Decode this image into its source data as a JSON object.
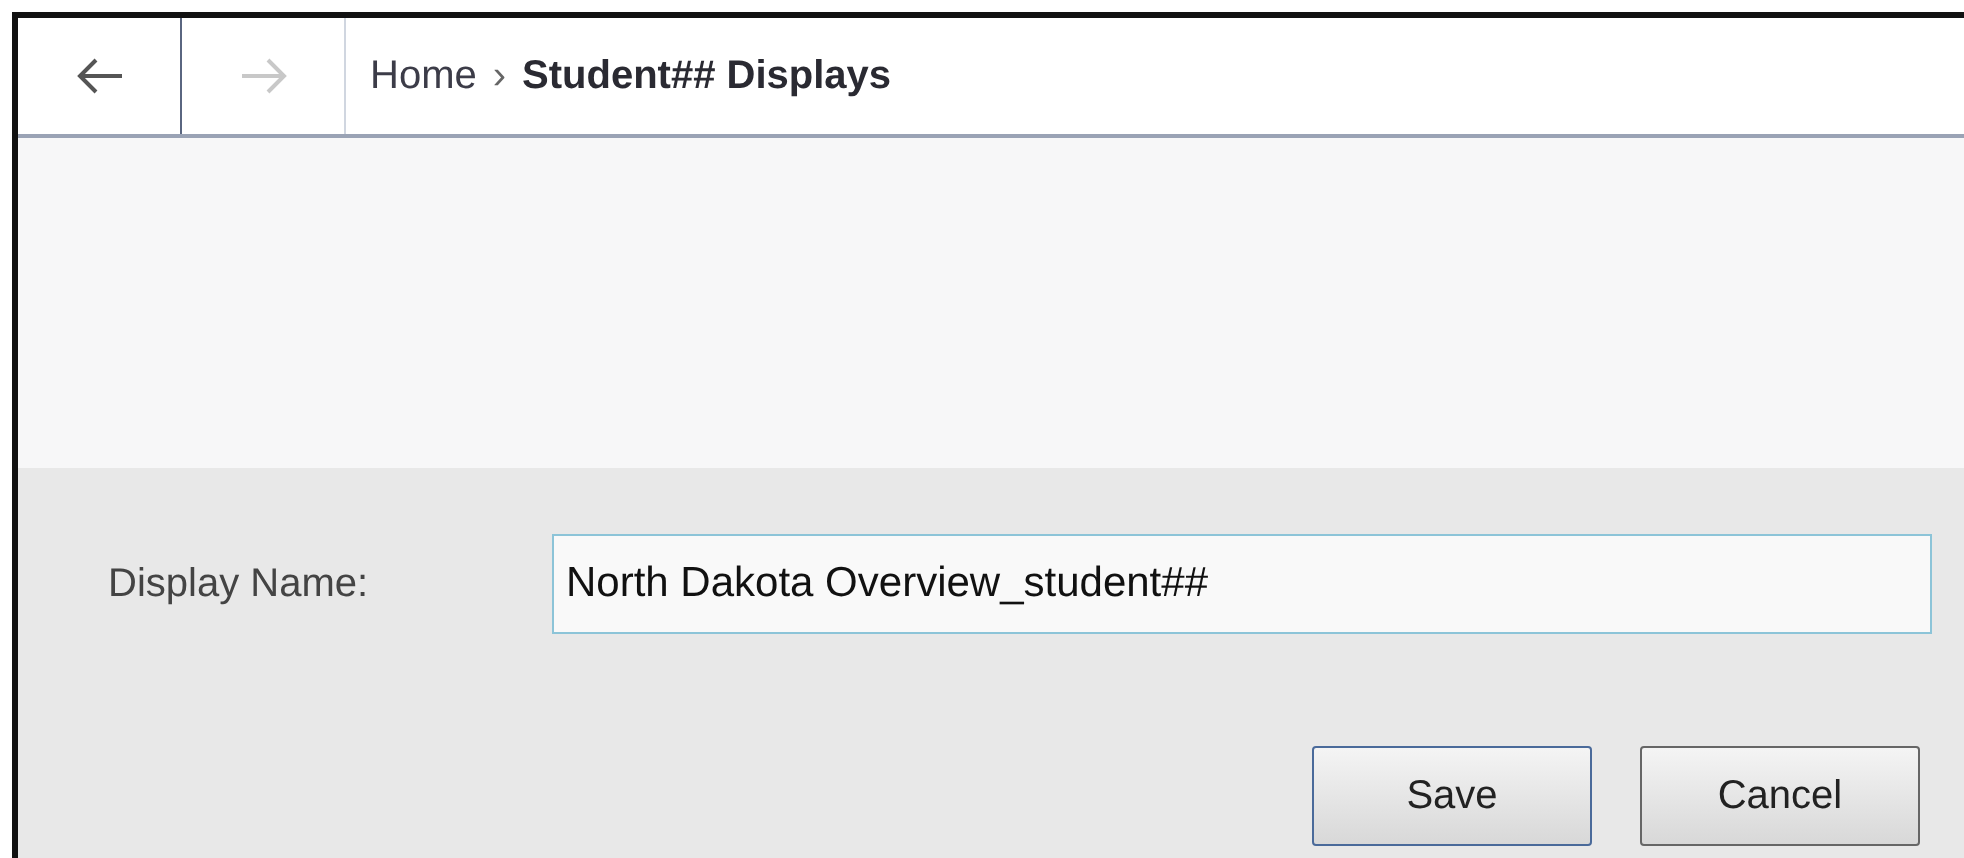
{
  "nav": [
    {
      "kind": "back",
      "disabled": false
    },
    {
      "kind": "forward",
      "disabled": true
    }
  ],
  "breadcrumb": {
    "home": "Home",
    "separator": "›",
    "current": "Student## Displays"
  },
  "form": {
    "label": "Display Name:",
    "value": "North Dakota Overview_student##"
  },
  "buttons": [
    {
      "label": "Save",
      "primary": true
    },
    {
      "label": "Cancel",
      "primary": false
    }
  ]
}
